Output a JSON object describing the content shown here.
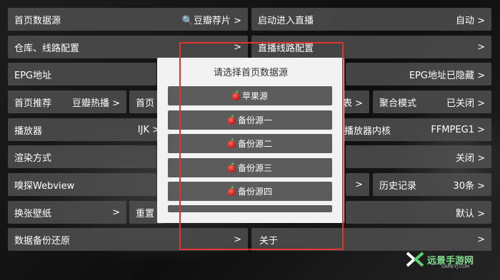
{
  "settings": {
    "home_source": {
      "label": "首页数据源",
      "value": "🔍豆瓣荐片 >"
    },
    "startup_live": {
      "label": "启动进入直播",
      "value": "自动 >"
    },
    "repo_config": {
      "label": "仓库、线路配置",
      "value": ">"
    },
    "live_config": {
      "label": "直播线路配置",
      "value": ">"
    },
    "epg": {
      "label": "EPG地址",
      "value": "EPG地址已隐藏 >"
    },
    "home_recommend": {
      "label": "首页推荐",
      "value": "豆瓣热播 >"
    },
    "home_partial": {
      "label": "首页"
    },
    "list_partial": {
      "value": "表 >"
    },
    "aggregate": {
      "label": "聚合模式",
      "value": "已关闭 >"
    },
    "player": {
      "label": "播放器",
      "value": "IJK >"
    },
    "player_core": {
      "label": "播放器内核",
      "value": "FFMPEG1 >"
    },
    "render": {
      "label": "渲染方式"
    },
    "close_value": {
      "value": "关闭 >"
    },
    "sniff": {
      "label": "嗅探Webview"
    },
    "sniff_right": {
      "value": ">"
    },
    "history": {
      "label": "历史记录",
      "value": "30条 >"
    },
    "wallpaper": {
      "label": "换张壁纸",
      "value": ">"
    },
    "reset": {
      "label": "重置"
    },
    "default_value": {
      "value": "默认 >"
    },
    "backup": {
      "label": "数据备份还原",
      "value": ">"
    },
    "about": {
      "label": "关于",
      "value": ">"
    }
  },
  "dialog": {
    "title": "请选择首页数据源",
    "options": [
      "苹果源",
      "备份源一",
      "备份源二",
      "备份源三",
      "备份源四"
    ]
  },
  "watermark": {
    "name": "远景手游网",
    "url": "GAMEYJ.COM"
  }
}
